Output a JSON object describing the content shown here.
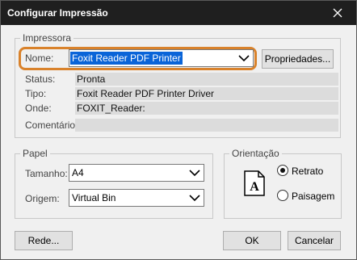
{
  "window": {
    "title": "Configurar Impressão"
  },
  "printer_group": {
    "legend": "Impressora",
    "name_label": "Nome:",
    "name_value": "Foxit Reader PDF Printer",
    "properties_button": "Propriedades...",
    "status_label": "Status:",
    "status_value": "Pronta",
    "type_label": "Tipo:",
    "type_value": "Foxit Reader PDF Printer Driver",
    "where_label": "Onde:",
    "where_value": "FOXIT_Reader:",
    "comment_label": "Comentário:",
    "comment_value": ""
  },
  "paper_group": {
    "legend": "Papel",
    "size_label": "Tamanho:",
    "size_value": "A4",
    "source_label": "Origem:",
    "source_value": "Virtual Bin"
  },
  "orientation_group": {
    "legend": "Orientação",
    "portrait_label": "Retrato",
    "landscape_label": "Paisagem",
    "selected": "Retrato",
    "doc_letter": "A"
  },
  "footer": {
    "network_button": "Rede...",
    "ok_button": "OK",
    "cancel_button": "Cancelar"
  },
  "colors": {
    "highlight": "#d9822b",
    "selection": "#0a64d8",
    "titlebar": "#1f1f1f"
  },
  "icons": [
    "close-icon",
    "chevron-down-icon",
    "document-portrait-icon"
  ]
}
